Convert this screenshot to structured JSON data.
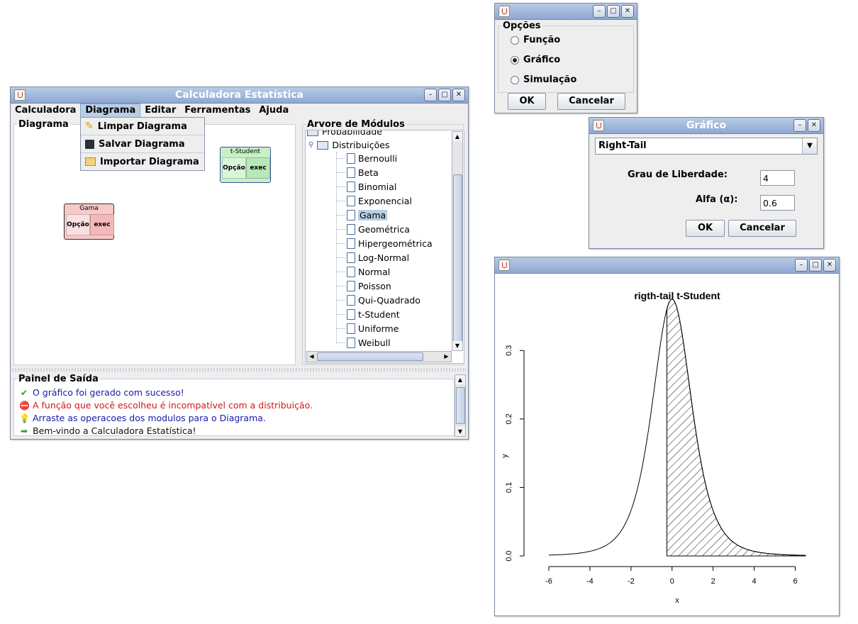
{
  "main_window": {
    "title": "Calculadora Estatística",
    "menu": [
      "Calculadora",
      "Diagrama",
      "Editar",
      "Ferramentas",
      "Ajuda"
    ],
    "active_menu_index": 1,
    "dropdown": [
      "Limpar Diagrama",
      "Salvar Diagrama",
      "Importar Diagrama"
    ],
    "diagram_panel": {
      "label": "Diagrama",
      "nodes": [
        {
          "title": "t-Student",
          "left_btn": "Opção",
          "right_btn": "exec",
          "color": "#c7f0c7"
        },
        {
          "title": "Gama",
          "left_btn": "Opção",
          "right_btn": "exec",
          "color": "#f7c9c9"
        }
      ]
    },
    "tree_panel": {
      "label": "Arvore de Módulos",
      "parent": "Probabilidade",
      "folder": "Distribuições",
      "items": [
        "Bernoulli",
        "Beta",
        "Binomial",
        "Exponencial",
        "Gama",
        "Geométrica",
        "Hipergeométrica",
        "Log-Normal",
        "Normal",
        "Poisson",
        "Qui-Quadrado",
        "t-Student",
        "Uniforme",
        "Weibull"
      ],
      "selected": "Gama"
    },
    "output_panel": {
      "label": "Painel de Saída",
      "messages": [
        {
          "icon": "check-icon",
          "text": "O gráfico foi gerado com sucesso!",
          "color": "#1a1aa8"
        },
        {
          "icon": "error-icon",
          "text": "A função que você escolheu é incompatível com a distribuição.",
          "color": "#d01818"
        },
        {
          "icon": "lightbulb-icon",
          "text": "Arraste as operacoes dos modulos para o Diagrama.",
          "color": "#1a1aa8"
        },
        {
          "icon": "arrow-right-icon",
          "text": "Bem-vindo a Calculadora Estatística!",
          "color": "#111111"
        }
      ]
    }
  },
  "options_dialog": {
    "group": "Opções",
    "radios": [
      "Função",
      "Gráfico",
      "Simulação"
    ],
    "selected_index": 1,
    "ok": "OK",
    "cancel": "Cancelar"
  },
  "grafico_dialog": {
    "title": "Gráfico",
    "combo_value": "Right-Tail",
    "grau_label": "Grau de Liberdade:",
    "grau_value": "4",
    "alfa_label": "Alfa (α):",
    "alfa_value": "0.6",
    "ok": "OK",
    "cancel": "Cancelar"
  },
  "plot_window": {
    "chart_data": {
      "type": "line",
      "title": "rigth-tail t-Student",
      "xlabel": "x",
      "ylabel": "y",
      "xlim": [
        -6,
        6.5
      ],
      "ylim": [
        0,
        0.35
      ],
      "x_ticks": [
        "-6",
        "-4",
        "-2",
        "0",
        "2",
        "4",
        "6"
      ],
      "y_ticks": [
        "0.0",
        "0.1",
        "0.2",
        "0.3"
      ],
      "series": [
        {
          "distribution": "t-Student",
          "df": 4,
          "shaded_from_x": -0.25,
          "shaded_to_x": 6.5
        }
      ]
    }
  }
}
